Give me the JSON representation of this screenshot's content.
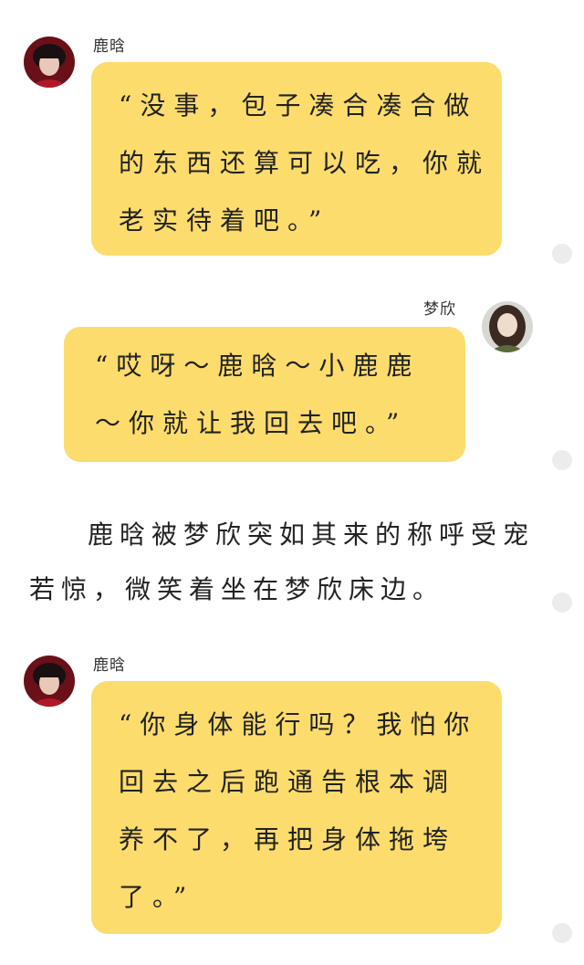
{
  "messages": [
    {
      "sender": "鹿晗",
      "text": "“没事，包子凑合凑合做\n的东西还算可以吃，你就\n老实待着吧。”"
    },
    {
      "sender": "梦欣",
      "text": "“哎呀～鹿晗～小鹿鹿\n～你就让我回去吧。”"
    },
    {
      "sender": "鹿晗",
      "text": "“你身体能行吗？我怕你\n回去之后跑通告根本调\n养不了，再把身体拖垮\n了。”"
    }
  ],
  "narration": "鹿晗被梦欣突如其来的称呼受宠若惊，微笑着坐在梦欣床边。",
  "colors": {
    "bubble": "#fcdc6c",
    "dot": "#ececec",
    "background": "#ffffff"
  }
}
